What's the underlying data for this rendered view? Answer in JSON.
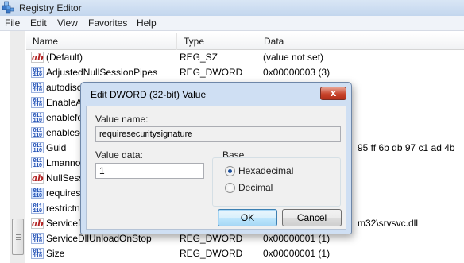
{
  "window": {
    "title": "Registry Editor",
    "icon": "registry-editor-icon"
  },
  "menu": [
    "File",
    "Edit",
    "View",
    "Favorites",
    "Help"
  ],
  "columns": {
    "name": "Name",
    "type": "Type",
    "data": "Data"
  },
  "rows": [
    {
      "icon": "string-value-icon",
      "name": "(Default)",
      "type": "REG_SZ",
      "data": "(value not set)"
    },
    {
      "icon": "binary-value-icon",
      "name": "AdjustedNullSessionPipes",
      "type": "REG_DWORD",
      "data": "0x00000003 (3)"
    },
    {
      "icon": "binary-value-icon",
      "name": "autodisc",
      "type": "",
      "data": ""
    },
    {
      "icon": "binary-value-icon",
      "name": "EnableA",
      "type": "",
      "data": ""
    },
    {
      "icon": "binary-value-icon",
      "name": "enablefo",
      "type": "",
      "data": ""
    },
    {
      "icon": "binary-value-icon",
      "name": "enablese",
      "type": "",
      "data": ""
    },
    {
      "icon": "binary-value-icon",
      "name": "Guid",
      "type": "",
      "data": "95 ff 6b db 97 c1 ad 4b"
    },
    {
      "icon": "binary-value-icon",
      "name": "Lmanno",
      "type": "",
      "data": ""
    },
    {
      "icon": "string-value-icon",
      "name": "NullSess",
      "type": "",
      "data": ""
    },
    {
      "icon": "binary-value-icon",
      "name": "requires",
      "type": "",
      "data": ""
    },
    {
      "icon": "binary-value-icon",
      "name": "restrictn",
      "type": "",
      "data": ""
    },
    {
      "icon": "string-value-icon",
      "name": "ServiceD",
      "type": "",
      "data": "m32\\srvsvc.dll"
    },
    {
      "icon": "binary-value-icon",
      "name": "ServiceDllUnloadOnStop",
      "type": "REG_DWORD",
      "data": "0x00000001 (1)"
    },
    {
      "icon": "binary-value-icon",
      "name": "Size",
      "type": "REG_DWORD",
      "data": "0x00000001 (1)"
    }
  ],
  "dialog": {
    "title": "Edit DWORD (32-bit) Value",
    "close_label": "x",
    "value_name_label": "Value name:",
    "value_name": "requiresecuritysignature",
    "value_data_label": "Value data:",
    "value_data": "1",
    "base_label": "Base",
    "hex_label": "Hexadecimal",
    "dec_label": "Decimal",
    "base_selected": "Hexadecimal",
    "ok_label": "OK",
    "cancel_label": "Cancel"
  },
  "colors": {
    "dialog_frame": "#cfdff3",
    "close_button": "#c8452d",
    "default_button": "#bee6fd"
  }
}
